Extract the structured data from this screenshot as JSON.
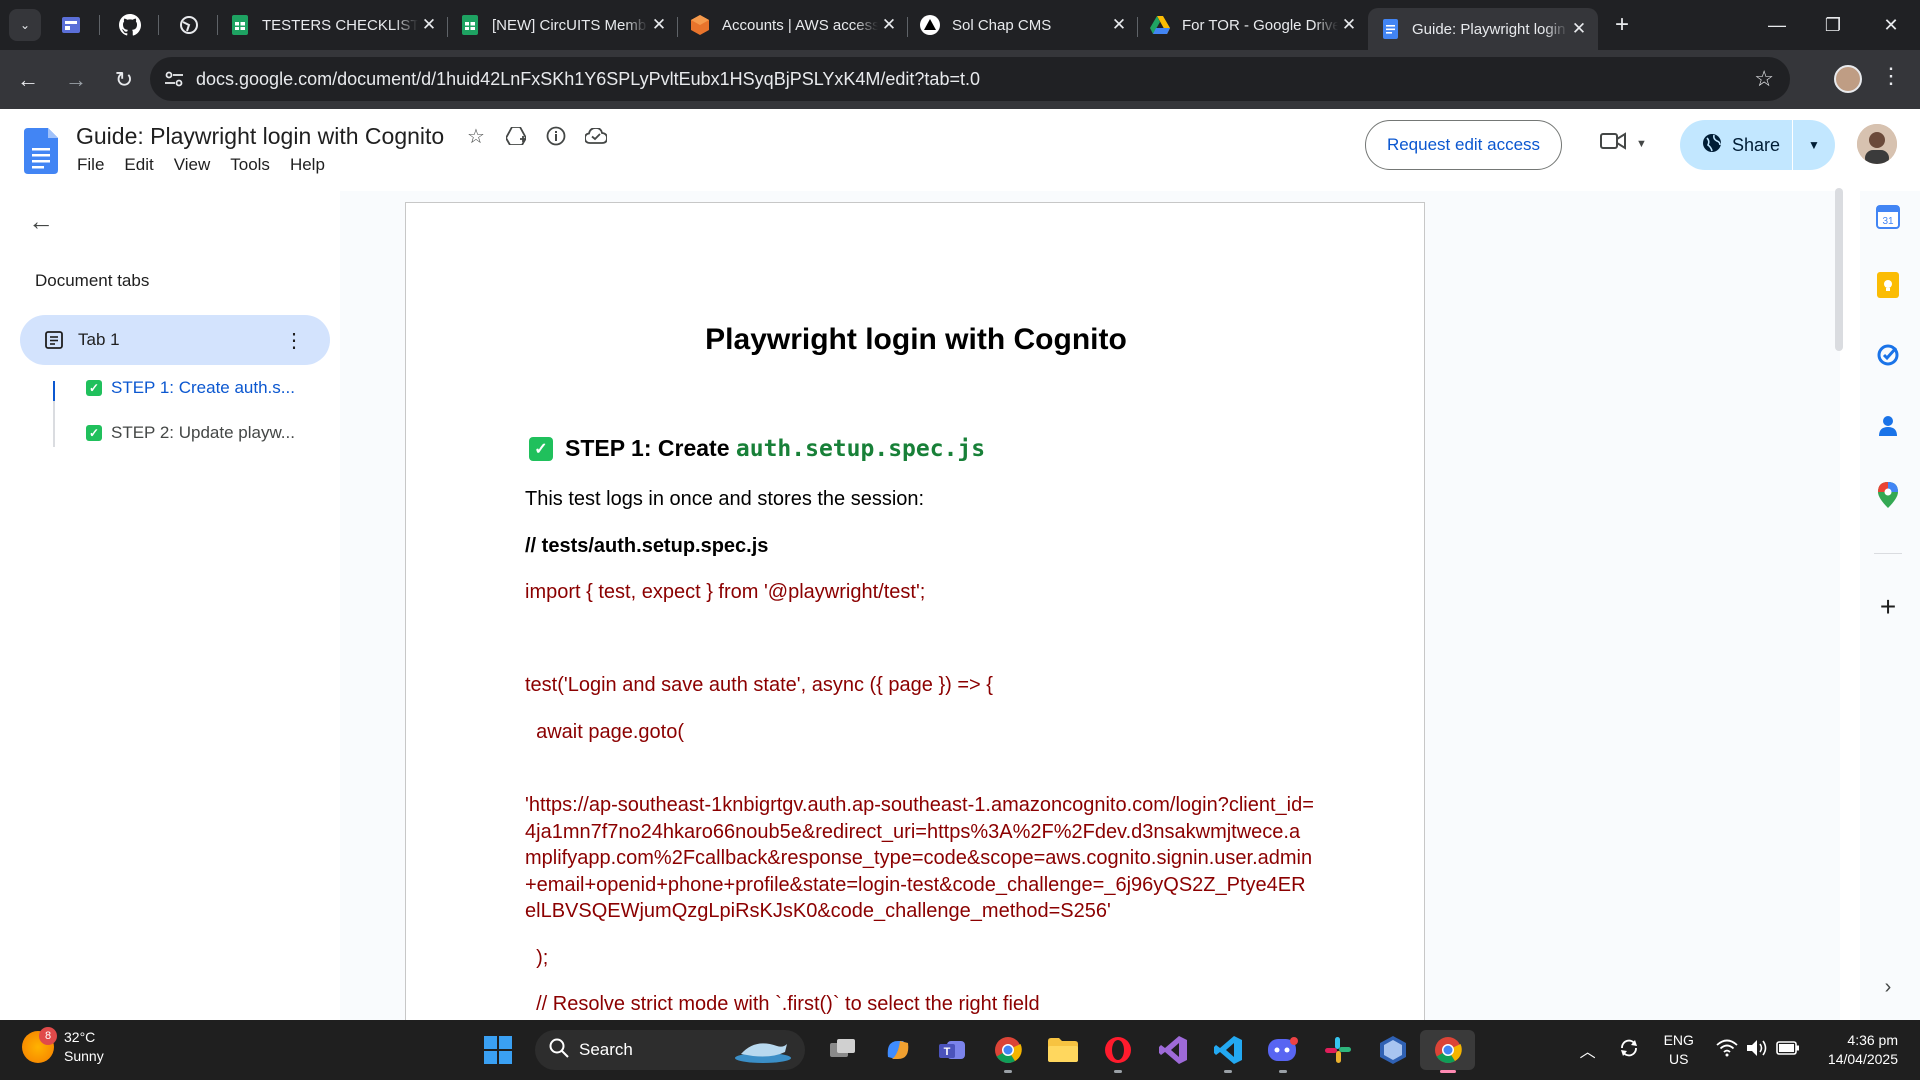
{
  "browser": {
    "tabs": [
      {
        "title": "TESTERS CHECKLIST - ",
        "favicon": "sheets-icon",
        "color": "#1ea362"
      },
      {
        "title": "[NEW] CircUITS Memb",
        "favicon": "sheets-icon",
        "color": "#1ea362"
      },
      {
        "title": "Accounts | AWS access",
        "favicon": "aws-icon",
        "color": "#e8742c"
      },
      {
        "title": "Sol Chap CMS",
        "favicon": "triangle-icon",
        "color": "#000000"
      },
      {
        "title": "For TOR - Google Drive",
        "favicon": "drive-icon",
        "color": "#1fa463"
      },
      {
        "title": "Guide: Playwright login",
        "favicon": "docs-icon",
        "color": "#4285f4",
        "active": true
      }
    ],
    "url": "docs.google.com/document/d/1huid42LnFxSKh1Y6SPLyPvltEubx1HSyqBjPSLYxK4M/edit?tab=t.0"
  },
  "docs": {
    "title": "Guide: Playwright login with Cognito",
    "menus": [
      "File",
      "Edit",
      "View",
      "Tools",
      "Help"
    ],
    "request_edit": "Request edit access",
    "share": "Share",
    "accent": "#c2e7ff"
  },
  "sidebar": {
    "heading": "Document tabs",
    "tab_label": "Tab 1",
    "outline": [
      "STEP 1: Create auth.s...",
      "STEP 2: Update playw..."
    ]
  },
  "content": {
    "h1": "Playwright login with Cognito",
    "step1_prefix": "STEP 1: Create ",
    "step1_code": "auth.setup.spec.js",
    "intro": "This test logs in once and stores the session:",
    "file_comment": "// tests/auth.setup.spec.js",
    "import_line": "import { test, expect } from '@playwright/test';",
    "test_line": "test('Login and save auth state', async ({ page }) => {",
    "goto_line": "  await page.goto(",
    "url_string": "'https://ap-southeast-1knbigrtgv.auth.ap-southeast-1.amazoncognito.com/login?client_id=4ja1mn7f7no24hkaro66noub5e&redirect_uri=https%3A%2F%2Fdev.d3nsakwmjtwece.amplifyapp.com%2Fcallback&response_type=code&scope=aws.cognito.signin.user.admin+email+openid+phone+profile&state=login-test&code_challenge=_6j96yQS2Z_Ptye4ERelLBVSQEWjumQzgLpiRsKJsK0&code_challenge_method=S256'",
    "close_paren": "  );",
    "resolve_comment": "  // Resolve strict mode with `.first()` to select the right field"
  },
  "taskbar": {
    "weather_temp": "32°C",
    "weather_desc": "Sunny",
    "weather_badge": "8",
    "search": "Search",
    "lang1": "ENG",
    "lang2": "US",
    "time": "4:36 pm",
    "date": "14/04/2025"
  }
}
